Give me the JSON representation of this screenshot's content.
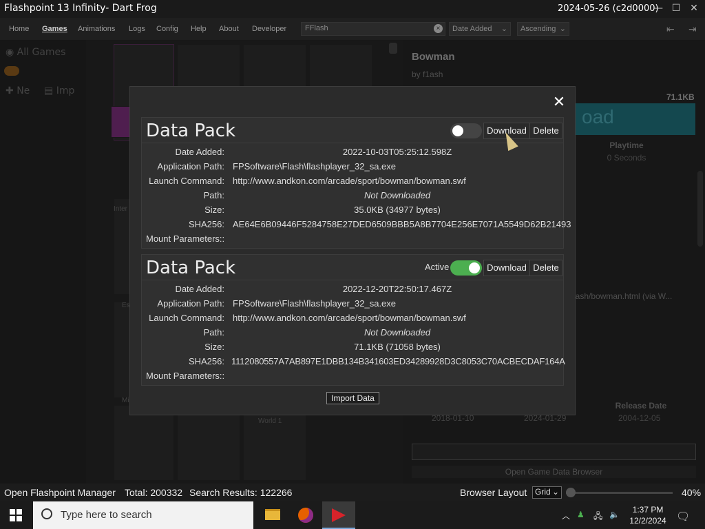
{
  "window": {
    "title": "Flashpoint 13 Infinity- Dart Frog",
    "version": "2024-05-26 (c2d0000)",
    "controls": [
      "minimize",
      "maximize",
      "close"
    ]
  },
  "nav": {
    "items": [
      "Home",
      "Games",
      "Animations",
      "Logs",
      "Config",
      "Help",
      "About",
      "Developer"
    ],
    "active": "Games",
    "search_value": "FFlash",
    "sort_field": "Date Added",
    "sort_order": "Ascending"
  },
  "sidebar": {
    "all_games": "All Games",
    "new_label": "Ne",
    "import_label": "Imp"
  },
  "grid": {
    "labels": [
      "Inter",
      "Es",
      "Mi",
      "World 1"
    ]
  },
  "details": {
    "title": "Bowman",
    "author": "by f1ash",
    "size": "71.1KB",
    "play_button": "oad",
    "playtime_label": "Playtime",
    "playtime_value": "0 Seconds",
    "launch_path": "lash/bowman.html (via W...",
    "release_date_label": "Release Date",
    "dates": [
      "2018-01-10",
      "2024-01-29",
      "2004-12-05"
    ],
    "open_browser": "Open Game Data Browser"
  },
  "modal": {
    "close_symbol": "✕",
    "import_button": "Import Data",
    "labels": {
      "active": "Active",
      "download": "Download",
      "delete": "Delete"
    },
    "packs": [
      {
        "title": "Data Pack",
        "active": false,
        "fields": [
          {
            "key": "Date Added:",
            "value": "2022-10-03T05:25:12.598Z"
          },
          {
            "key": "Application Path:",
            "value": "FPSoftware\\Flash\\flashplayer_32_sa.exe"
          },
          {
            "key": "Launch Command:",
            "value": "http://www.andkon.com/arcade/sport/bowman/bowman.swf"
          },
          {
            "key": "Path:",
            "value": "Not Downloaded"
          },
          {
            "key": "Size:",
            "value": "35.0KB (34977 bytes)"
          },
          {
            "key": "SHA256:",
            "value": "AE64E6B09446F5284758E27DED6509BBB5A8B7704E256E7071A5549D62B21493"
          },
          {
            "key": "Mount Parameters::",
            "value": ""
          }
        ]
      },
      {
        "title": "Data Pack",
        "active": true,
        "fields": [
          {
            "key": "Date Added:",
            "value": "2022-12-20T22:50:17.467Z"
          },
          {
            "key": "Application Path:",
            "value": "FPSoftware\\Flash\\flashplayer_32_sa.exe"
          },
          {
            "key": "Launch Command:",
            "value": "http://www.andkon.com/arcade/sport/bowman/bowman.swf"
          },
          {
            "key": "Path:",
            "value": "Not Downloaded"
          },
          {
            "key": "Size:",
            "value": "71.1KB (71058 bytes)"
          },
          {
            "key": "SHA256:",
            "value": "1112080557A7AB897E1DBB134B341603ED34289928D3C8053C70ACBECDAF164A"
          },
          {
            "key": "Mount Parameters::",
            "value": ""
          }
        ]
      }
    ]
  },
  "status": {
    "manager": "Open Flashpoint Manager",
    "total": "Total: 200332",
    "results": "Search Results: 122266",
    "browser_layout": "Browser Layout",
    "layout_value": "Grid",
    "zoom": "40%"
  },
  "taskbar": {
    "search_placeholder": "Type here to search",
    "time": "1:37 PM",
    "date": "12/2/2024",
    "apps": [
      "file-explorer-icon",
      "firefox-icon",
      "flashpoint-icon"
    ]
  },
  "colors": {
    "accent_green": "#4caf50",
    "play_button": "#1f6f7a",
    "background": "#202020"
  }
}
